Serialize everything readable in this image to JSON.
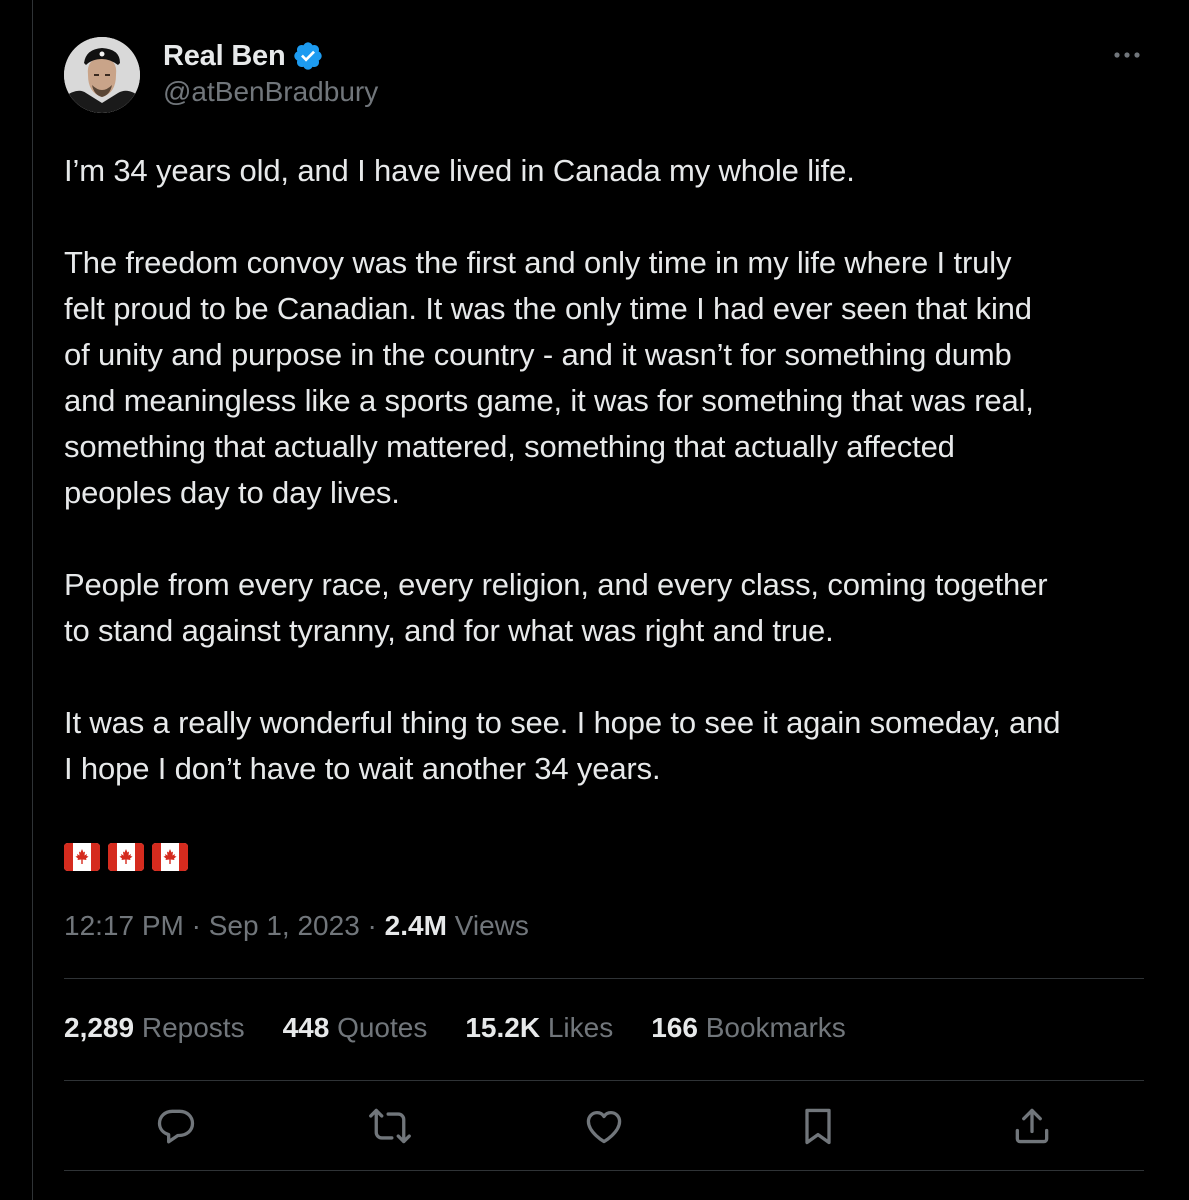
{
  "author": {
    "display_name": "Real Ben",
    "handle": "@atBenBradbury",
    "verified": true,
    "verified_color": "#1d9bf0"
  },
  "tweet": {
    "paragraphs": [
      "I’m 34 years old, and I have lived in Canada my whole life.",
      "The freedom convoy was the first and only time in my life where I truly\nfelt proud to be Canadian. It was the only time I had ever seen that kind\nof unity and purpose in the country - and it wasn’t for something dumb\nand meaningless like a sports game, it was for something that was real,\nsomething that actually mattered, something that actually affected\npeoples day to day lives.",
      "People from every race, every religion, and every class, coming together\nto stand against tyranny, and for what was right and true.",
      "It was a really wonderful thing to see. I hope to see it again someday, and\nI hope I don’t have to wait another 34 years."
    ],
    "flags": [
      "canada-flag",
      "canada-flag",
      "canada-flag"
    ]
  },
  "meta": {
    "time": "12:17 PM",
    "date": "Sep 1, 2023",
    "separator": " · ",
    "views_count": "2.4M",
    "views_label": "Views"
  },
  "stats": {
    "reposts": {
      "count": "2,289",
      "label": "Reposts"
    },
    "quotes": {
      "count": "448",
      "label": "Quotes"
    },
    "likes": {
      "count": "15.2K",
      "label": "Likes"
    },
    "bookmarks": {
      "count": "166",
      "label": "Bookmarks"
    }
  },
  "actions": [
    "reply-icon",
    "repost-icon",
    "like-icon",
    "bookmark-icon",
    "share-icon"
  ],
  "colors": {
    "background": "#000000",
    "text_primary": "#e7e9ea",
    "text_secondary": "#71767b",
    "divider": "#2f3336"
  }
}
